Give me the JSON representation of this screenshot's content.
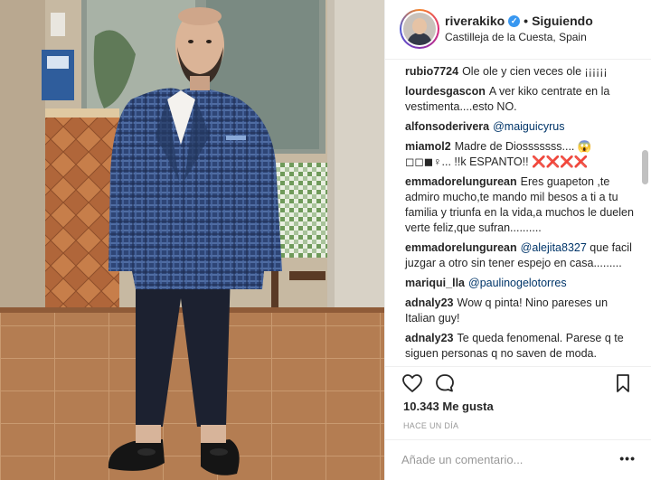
{
  "colors": {
    "link": "#003569",
    "verified": "#3897f0",
    "muted": "#999999",
    "text": "#262626",
    "red_x": "#ed4956"
  },
  "header": {
    "username": "riverakiko",
    "verified_icon": "verified-badge-icon",
    "dot": "•",
    "follow_status": "Siguiendo",
    "location": "Castilleja de la Cuesta, Spain"
  },
  "comments": [
    {
      "user": "rubio7724",
      "text": "Ole ole y cien veces ole ¡¡¡¡¡¡",
      "mention": ""
    },
    {
      "user": "lourdesgascon",
      "text": "A ver kiko centrate en la vestimenta....esto NO.",
      "mention": ""
    },
    {
      "user": "alfonsoderivera",
      "text": "",
      "mention": "@maiguicyrus"
    },
    {
      "user": "miamol2",
      "text": "Madre de Diosssssss.... 😱◻◻◼♀... !!k ESPANTO!! ❌❌❌❌",
      "mention": ""
    },
    {
      "user": "emmadorelungurean",
      "text": "Eres guapeton ,te admiro mucho,te mando mil besos a ti a tu familia y triunfa en la vida,a muchos le duelen verte feliz,que sufran..........",
      "mention": ""
    },
    {
      "user": "emmadorelungurean",
      "text": "que facil juzgar a otro sin tener espejo en casa.........",
      "mention": "@alejita8327"
    },
    {
      "user": "mariqui_lla",
      "text": "",
      "mention": "@paulinogelotorres"
    },
    {
      "user": "adnaly23",
      "text": "Wow q pinta! Nino pareses un Italian guy!",
      "mention": ""
    },
    {
      "user": "adnaly23",
      "text": "Te queda fenomenal. Parese q te siguen personas q no saven de moda.",
      "mention": ""
    }
  ],
  "actions": {
    "like_icon": "heart-icon",
    "comment_icon": "comment-icon",
    "save_icon": "bookmark-icon",
    "likes": "10.343 Me gusta",
    "time": "HACE UN DÍA"
  },
  "add_comment": {
    "placeholder": "Añade un comentario...",
    "more": "•••"
  }
}
